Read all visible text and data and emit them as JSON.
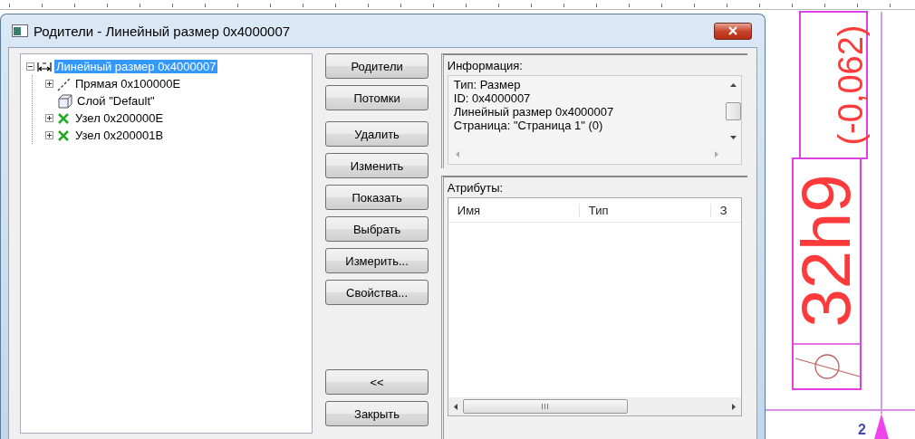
{
  "window": {
    "title": "Родители - Линейный размер 0x4000007"
  },
  "tree": [
    {
      "label": "Линейный размер 0x4000007",
      "kind": "dimension",
      "selected": true,
      "expanded": true,
      "children": [
        {
          "label": "Прямая 0x100000E",
          "kind": "line",
          "selected": false,
          "expanded": false
        },
        {
          "label": "Слой \"Default\"",
          "kind": "layer",
          "selected": false
        },
        {
          "label": "Узел 0x200000E",
          "kind": "node",
          "selected": false,
          "expanded": false
        },
        {
          "label": "Узел 0x200001B",
          "kind": "node",
          "selected": false,
          "expanded": false
        }
      ]
    }
  ],
  "button_groups": [
    [
      "Родители",
      "Потомки"
    ],
    [
      "Удалить",
      "Изменить",
      "Показать",
      "Выбрать",
      "Измерить...",
      "Свойства..."
    ],
    [
      "<<",
      "Закрыть"
    ]
  ],
  "info": {
    "label": "Информация:",
    "lines": [
      "Тип: Размер",
      "ID: 0x4000007",
      "Линейный размер 0x4000007",
      "Страница: \"Страница 1\" (0)"
    ]
  },
  "attributes": {
    "label": "Атрибуты:",
    "columns": [
      "Имя",
      "Тип",
      "З"
    ]
  },
  "drawing": {
    "dimension_text": "32h9",
    "tolerance": "(-0,062)",
    "sheet_number": "2"
  }
}
